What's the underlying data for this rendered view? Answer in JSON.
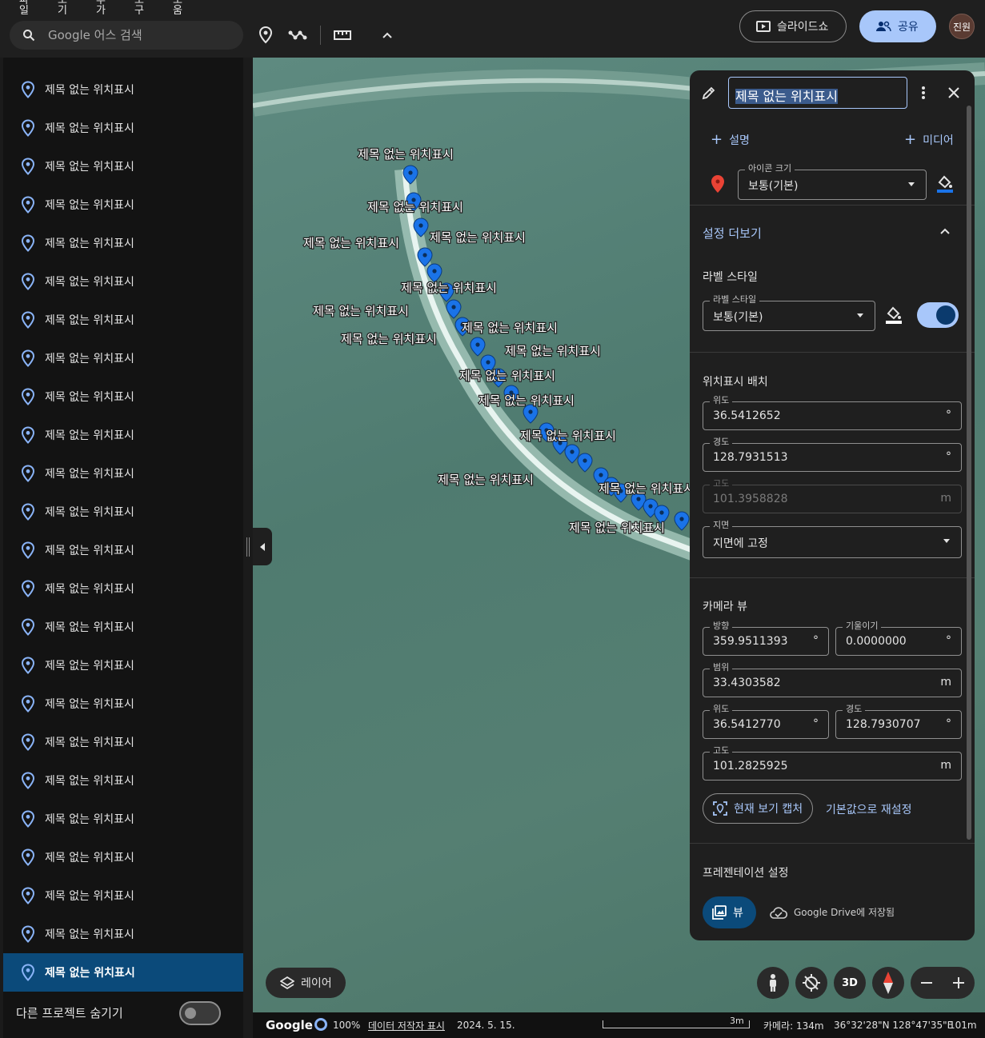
{
  "menu": [
    "파일",
    "보기",
    "추가",
    "도구",
    "도움"
  ],
  "search": {
    "placeholder": "Google 어스 검색"
  },
  "header": {
    "slideshow_label": "슬라이드쇼",
    "share_label": "공유",
    "avatar_label": "진원"
  },
  "sidebar": {
    "items": [
      {
        "label": "제목 없는 위치표시"
      },
      {
        "label": "제목 없는 위치표시"
      },
      {
        "label": "제목 없는 위치표시"
      },
      {
        "label": "제목 없는 위치표시"
      },
      {
        "label": "제목 없는 위치표시"
      },
      {
        "label": "제목 없는 위치표시"
      },
      {
        "label": "제목 없는 위치표시"
      },
      {
        "label": "제목 없는 위치표시"
      },
      {
        "label": "제목 없는 위치표시"
      },
      {
        "label": "제목 없는 위치표시"
      },
      {
        "label": "제목 없는 위치표시"
      },
      {
        "label": "제목 없는 위치표시"
      },
      {
        "label": "제목 없는 위치표시"
      },
      {
        "label": "제목 없는 위치표시"
      },
      {
        "label": "제목 없는 위치표시"
      },
      {
        "label": "제목 없는 위치표시"
      },
      {
        "label": "제목 없는 위치표시"
      },
      {
        "label": "제목 없는 위치표시"
      },
      {
        "label": "제목 없는 위치표시"
      },
      {
        "label": "제목 없는 위치표시"
      },
      {
        "label": "제목 없는 위치표시"
      },
      {
        "label": "제목 없는 위치표시"
      },
      {
        "label": "제목 없는 위치표시"
      },
      {
        "label": "제목 없는 위치표시"
      }
    ],
    "selected_index": 23,
    "hide_other_projects_label": "다른 프로젝트 숨기기",
    "hide_other_projects_on": false
  },
  "map": {
    "placemark_label": "제목 없는 위치표시",
    "layers_label": "레이어",
    "mode_3d_label": "3D"
  },
  "statusbar": {
    "logo": "Google",
    "load_percent": "100%",
    "attribution": "데이터 저작자 표시",
    "imagery_date": "2024. 5. 15.",
    "scale_label": "3m",
    "camera": "카메라: 134m",
    "coordinates": "36°32'28\"N 128°47'35\"E",
    "altitude": "101m"
  },
  "editor": {
    "title_value": "제목 없는 위치표시",
    "add_description_label": "설명",
    "add_media_label": "미디어",
    "icon_size": {
      "label": "아이콘 크기",
      "value": "보통(기본)"
    },
    "more_settings_label": "설정 더보기",
    "label_style_section": "라벨 스타일",
    "label_style": {
      "label": "라벨 스타일",
      "value": "보통(기본)"
    },
    "label_visible": true,
    "placement_section": "위치표시 배치",
    "latitude": {
      "label": "위도",
      "value": "36.5412652",
      "unit": "°"
    },
    "longitude": {
      "label": "경도",
      "value": "128.7931513",
      "unit": "°"
    },
    "altitude": {
      "label": "고도",
      "value": "101.3958828",
      "unit": "m"
    },
    "ground": {
      "label": "지면",
      "value": "지면에 고정"
    },
    "camera_section": "카메라 뷰",
    "heading": {
      "label": "방향",
      "value": "359.9511393",
      "unit": "°"
    },
    "tilt": {
      "label": "기울이기",
      "value": "0.0000000",
      "unit": "°"
    },
    "range": {
      "label": "범위",
      "value": "33.4303582",
      "unit": "m"
    },
    "cam_latitude": {
      "label": "위도",
      "value": "36.5412770",
      "unit": "°"
    },
    "cam_longitude": {
      "label": "경도",
      "value": "128.7930707",
      "unit": "°"
    },
    "cam_altitude": {
      "label": "고도",
      "value": "101.2825925",
      "unit": "m"
    },
    "capture_label": "현재 보기 캡처",
    "reset_label": "기본값으로 재설정",
    "presentation_section": "프레젠테이션 설정",
    "view_label": "뷰",
    "drive_status": "Google Drive에 저장됨"
  },
  "colors": {
    "accent": "#a8c7fa",
    "selected_bg": "#0b4a7a",
    "pin_blue": "#1a73e8",
    "pin_red": "#ea4335"
  }
}
